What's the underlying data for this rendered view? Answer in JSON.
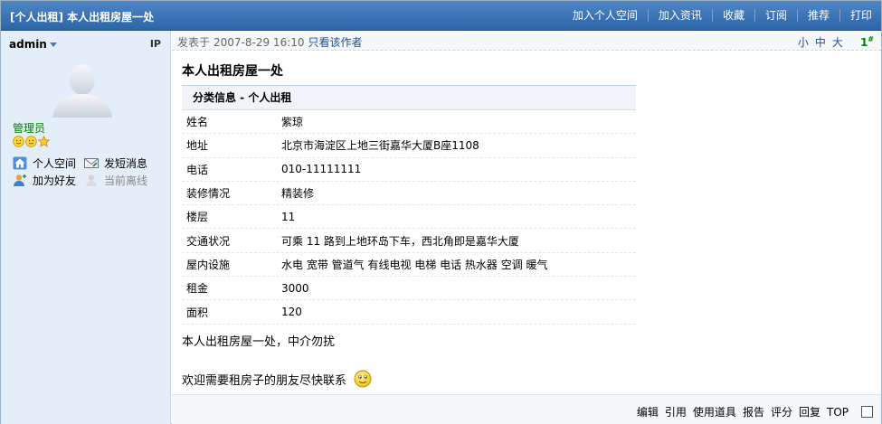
{
  "header": {
    "title": "[个人出租] 本人出租房屋一处",
    "actions": [
      "加入个人空间",
      "加入资讯",
      "收藏",
      "订阅",
      "推荐",
      "打印"
    ]
  },
  "sidebar": {
    "username": "admin",
    "ip": "IP",
    "role": "管理员",
    "links": {
      "space": "个人空间",
      "message": "发短消息",
      "friend": "加为好友",
      "status": "当前离线"
    }
  },
  "post": {
    "posted_label": "发表于",
    "date": "2007-8-29 16:10",
    "only_author": "只看该作者",
    "font_sizes": [
      "小",
      "中",
      "大"
    ],
    "floor": "1",
    "floor_mark": "#",
    "title": "本人出租房屋一处",
    "table_header": "分类信息  - 个人出租",
    "fields": [
      {
        "k": "姓名",
        "v": "紫琼"
      },
      {
        "k": "地址",
        "v": "北京市海淀区上地三街嘉华大厦B座1108"
      },
      {
        "k": "电话",
        "v": "010-11111111"
      },
      {
        "k": "装修情况",
        "v": "精装修"
      },
      {
        "k": "楼层",
        "v": "11"
      },
      {
        "k": "交通状况",
        "v": "可乘  11 路到上地环岛下车，西北角即是嘉华大厦"
      },
      {
        "k": "屋内设施",
        "v": "水电 宽带 管道气 有线电视 电梯 电话 热水器 空调 暖气"
      },
      {
        "k": "租金",
        "v": "3000"
      },
      {
        "k": "面积",
        "v": "120"
      }
    ],
    "body_line1": "本人出租房屋一处，中介勿扰",
    "body_line2": "欢迎需要租房子的朋友尽快联系"
  },
  "footer": {
    "tools": [
      "编辑",
      "引用",
      "使用道具",
      "报告",
      "评分",
      "回复",
      "TOP"
    ]
  },
  "colors": {
    "header_bg": "#2b64a8",
    "sidebar_bg": "#e4eef8",
    "link_blue": "#1c4f9c",
    "role_green": "#008000"
  }
}
